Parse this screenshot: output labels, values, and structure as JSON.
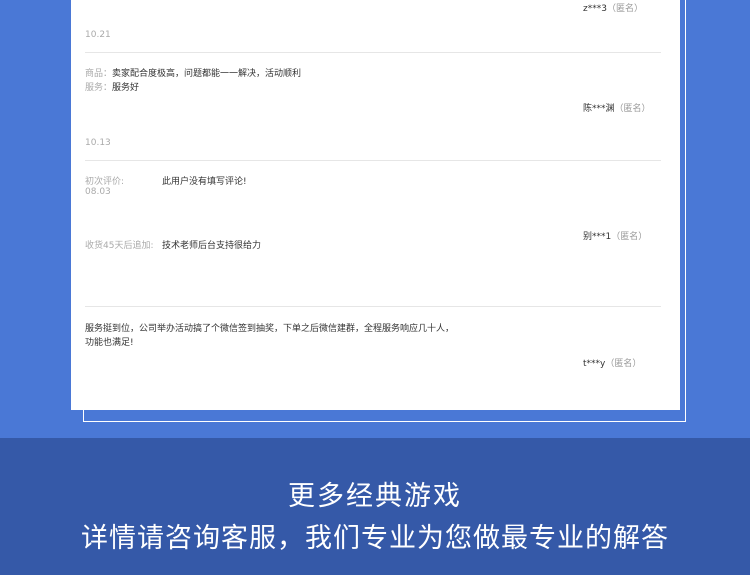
{
  "reviews": [
    {
      "user": "z***3",
      "anon": "（匿名）",
      "date": "10.21"
    },
    {
      "product_label": "商品：",
      "product_text": "卖家配合度极高，问题都能一一解决，活动顺利",
      "service_label": "服务：",
      "service_text": "服务好",
      "user": "陈***渊",
      "anon": "（匿名）",
      "date": "10.13"
    },
    {
      "initial_label": "初次评价:",
      "initial_text": "此用户没有填写评论!",
      "date": "08.03",
      "followup_label": "收货45天后追加:",
      "followup_text": "技术老师后台支持很给力",
      "user": "别***1",
      "anon": "（匿名）"
    },
    {
      "text_line1": "服务挺到位，公司举办活动搞了个微信签到抽奖，下单之后微信建群，全程服务响应几十人，",
      "text_line2": "功能也满足!",
      "user": "t***y",
      "anon": "（匿名）"
    }
  ],
  "footer": {
    "line1": "更多经典游戏",
    "line2": "详情请咨询客服，我们专业为您做最专业的解答"
  },
  "colors": {
    "background": "#4a78d6",
    "footer": "#3559a8",
    "card": "#ffffff"
  }
}
